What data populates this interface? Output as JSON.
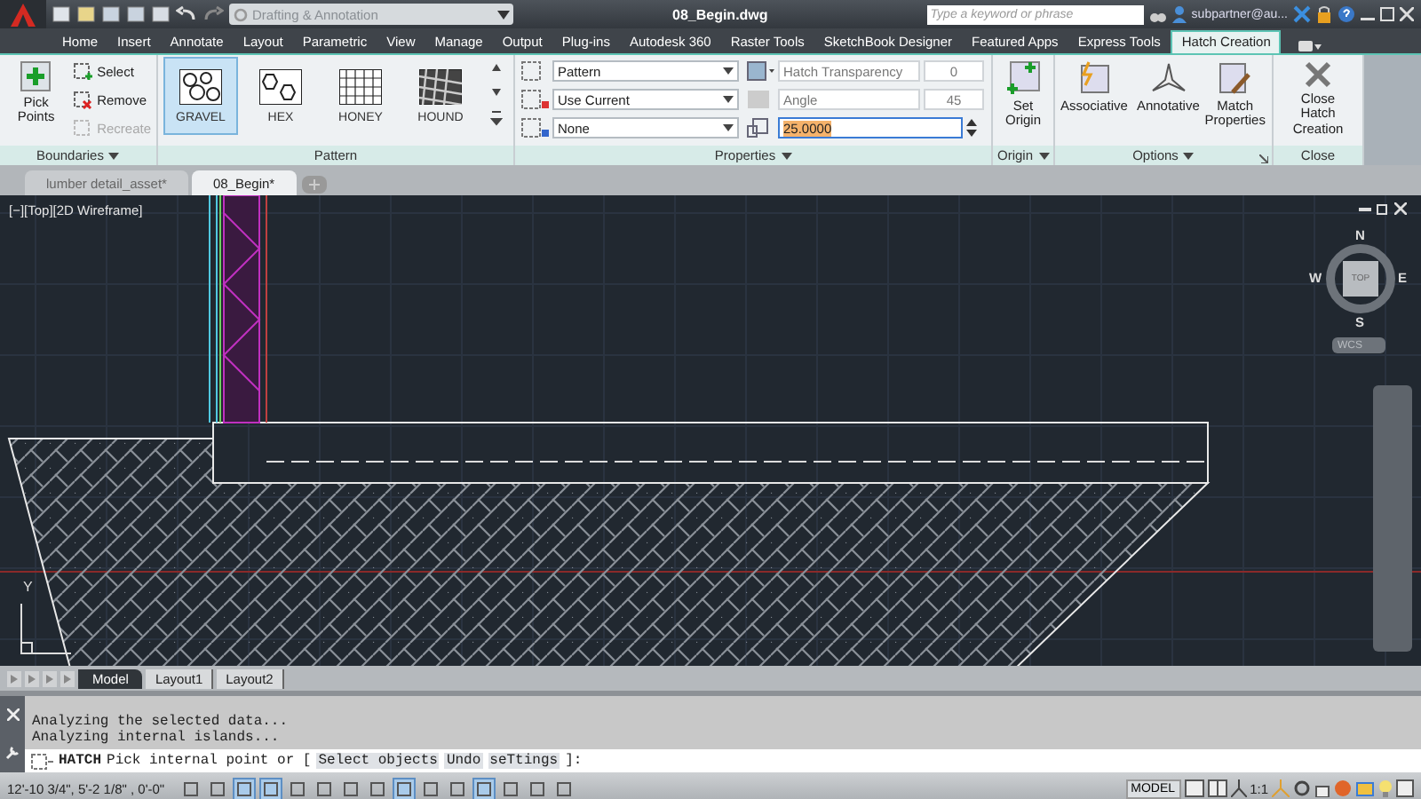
{
  "title_bar": {
    "workspace": "Drafting & Annotation",
    "title": "08_Begin.dwg",
    "search_placeholder": "Type a keyword or phrase",
    "user": "subpartner@au..."
  },
  "ribbon_tabs": [
    {
      "label": "Home",
      "selected": false
    },
    {
      "label": "Insert",
      "selected": false
    },
    {
      "label": "Annotate",
      "selected": false
    },
    {
      "label": "Layout",
      "selected": false
    },
    {
      "label": "Parametric",
      "selected": false
    },
    {
      "label": "View",
      "selected": false
    },
    {
      "label": "Manage",
      "selected": false
    },
    {
      "label": "Output",
      "selected": false
    },
    {
      "label": "Plug-ins",
      "selected": false
    },
    {
      "label": "Autodesk 360",
      "selected": false
    },
    {
      "label": "Raster Tools",
      "selected": false
    },
    {
      "label": "SketchBook Designer",
      "selected": false
    },
    {
      "label": "Featured Apps",
      "selected": false
    },
    {
      "label": "Express Tools",
      "selected": false
    },
    {
      "label": "Hatch Creation",
      "selected": true
    }
  ],
  "boundaries": {
    "title": "Boundaries",
    "pick": "Pick Points",
    "items": [
      {
        "label": "Select",
        "disabled": false
      },
      {
        "label": "Remove",
        "disabled": false
      },
      {
        "label": "Recreate",
        "disabled": true
      }
    ]
  },
  "patterns": {
    "title": "Pattern",
    "items": [
      {
        "label": "GRAVEL",
        "selected": true
      },
      {
        "label": "HEX",
        "selected": false
      },
      {
        "label": "HONEY",
        "selected": false
      },
      {
        "label": "HOUND",
        "selected": false
      }
    ]
  },
  "properties": {
    "title": "Properties",
    "type": "Pattern",
    "hatch_color": "Use Current",
    "background": "None",
    "transparency_label": "Hatch Transparency",
    "transparency": "0",
    "angle_label": "Angle",
    "angle": "45",
    "scale": "25.0000"
  },
  "origin": {
    "title": "Origin",
    "button": "Set Origin"
  },
  "options": {
    "title": "Options",
    "buttons": [
      "Associative",
      "Annotative",
      "Match Properties"
    ]
  },
  "close": {
    "title": "Close",
    "button": "Close Hatch Creation"
  },
  "file_tabs": [
    {
      "label": "lumber detail_asset*",
      "selected": false
    },
    {
      "label": "08_Begin*",
      "selected": true
    }
  ],
  "viewport": {
    "label": "[−][Top][2D Wireframe]",
    "compass": [
      "N",
      "E",
      "S",
      "W"
    ],
    "cube_face": "TOP",
    "ucs_button": "WCS",
    "axis_label": "Y"
  },
  "layout_tabs": [
    {
      "kind": "model",
      "label": "Model",
      "selected": true
    },
    {
      "kind": "layout",
      "label": "Layout1",
      "selected": false
    },
    {
      "kind": "layout",
      "label": "Layout2",
      "selected": false
    }
  ],
  "command": {
    "history": [
      "Analyzing the selected data...",
      "Analyzing internal islands..."
    ],
    "command": "HATCH",
    "prompt": "Pick internal point or [",
    "options": [
      "Select objects",
      "Undo",
      "seTtings"
    ],
    "suffix": "]:"
  },
  "status_bar": {
    "coordinates": "12'-10 3/4\", 5'-2 1/8\" , 0'-0\"",
    "toggles": [
      {
        "on": false
      },
      {
        "on": false
      },
      {
        "on": true
      },
      {
        "on": true
      },
      {
        "on": false
      },
      {
        "on": false
      },
      {
        "on": false
      },
      {
        "on": false
      },
      {
        "on": true
      },
      {
        "on": false
      },
      {
        "on": false
      },
      {
        "on": true
      },
      {
        "on": false
      },
      {
        "on": false
      },
      {
        "on": false
      }
    ],
    "space": "MODEL",
    "scale": "1:1"
  }
}
